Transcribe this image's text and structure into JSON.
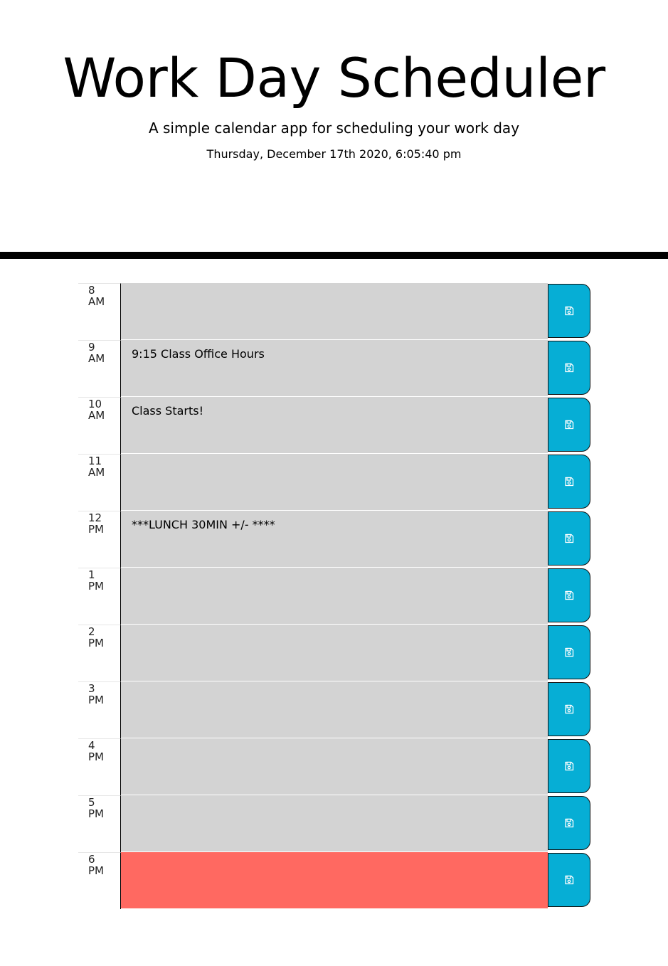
{
  "header": {
    "title": "Work Day Scheduler",
    "subtitle": "A simple calendar app for scheduling your work day",
    "current_day": "Thursday, December 17th 2020, 6:05:40 pm"
  },
  "colors": {
    "past": "#d3d3d3",
    "present": "#ff6961",
    "save_button": "#06aed5"
  },
  "save_icon": "save-icon",
  "time_blocks": [
    {
      "hour": "8",
      "period": "AM",
      "text": "",
      "status": "past"
    },
    {
      "hour": "9",
      "period": "AM",
      "text": "9:15 Class Office Hours",
      "status": "past"
    },
    {
      "hour": "10",
      "period": "AM",
      "text": "Class Starts!",
      "status": "past"
    },
    {
      "hour": "11",
      "period": "AM",
      "text": "",
      "status": "past"
    },
    {
      "hour": "12",
      "period": "PM",
      "text": "***LUNCH 30MIN +/- ****",
      "status": "past"
    },
    {
      "hour": "1",
      "period": "PM",
      "text": "",
      "status": "past"
    },
    {
      "hour": "2",
      "period": "PM",
      "text": "",
      "status": "past"
    },
    {
      "hour": "3",
      "period": "PM",
      "text": "",
      "status": "past"
    },
    {
      "hour": "4",
      "period": "PM",
      "text": "",
      "status": "past"
    },
    {
      "hour": "5",
      "period": "PM",
      "text": "",
      "status": "past"
    },
    {
      "hour": "6",
      "period": "PM",
      "text": "",
      "status": "present"
    }
  ]
}
